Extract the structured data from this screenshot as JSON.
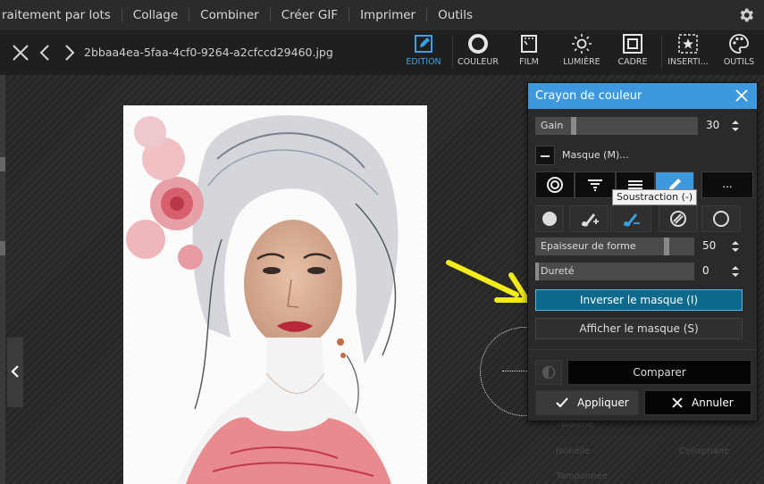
{
  "menu": {
    "items": [
      "raitement par lots",
      "Collage",
      "Combiner",
      "Créer GIF",
      "Imprimer",
      "Outils"
    ]
  },
  "toolbar": {
    "filename": "2bbaa4ea-5faa-4cf0-9264-a2cfccd29460.jpg",
    "tools": {
      "edition": "EDITION",
      "couleur": "COULEUR",
      "film": "FILM",
      "lumiere": "LUMIÈRE",
      "cadre": "CADRE",
      "insertion": "INSERTI...",
      "outils": "OUTILS"
    },
    "active_color": "#3aa0e8"
  },
  "dialog": {
    "title": "Crayon de couleur",
    "gain": {
      "label": "Gain",
      "value": "30",
      "level": 0.05
    },
    "mask_label": "Masque (M)...",
    "more_label": "...",
    "tooltip": "Soustraction (-)",
    "shape_thickness": {
      "label": "Epaisseur de forme",
      "value": "50",
      "level": 0.82
    },
    "hardness": {
      "label": "Dureté",
      "value": "0",
      "level": 0.0
    },
    "invert_mask": "Inverser le masque (I)",
    "show_mask": "Afficher le masque (S)",
    "compare": "Comparer",
    "apply": "Appliquer",
    "cancel": "Annuler",
    "accent_color": "#3d98dd"
  },
  "background_panel": {
    "ghost_items": [
      "Isolerie",
      "Isohélie",
      "Cellophane",
      "Tamponnée"
    ]
  },
  "annotation": {
    "arrow_color": "#f2ec1a"
  }
}
